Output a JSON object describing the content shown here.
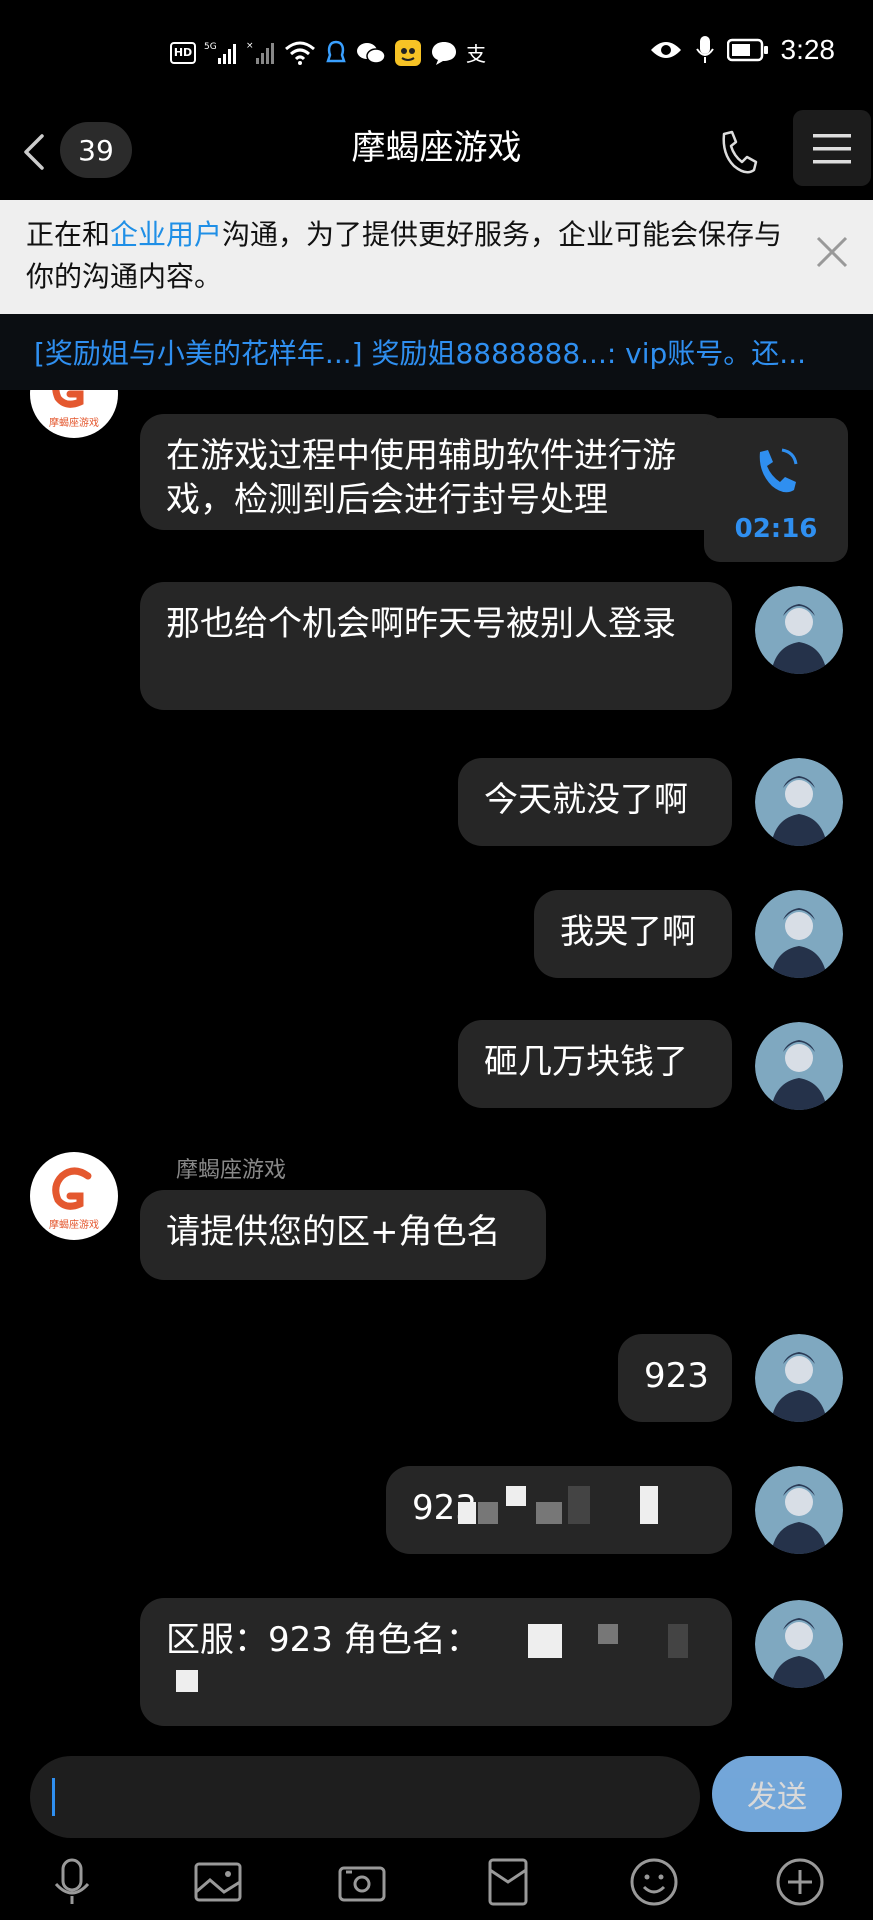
{
  "status_bar": {
    "time": "3:28",
    "hd_label": "HD",
    "icons": [
      "hd-icon",
      "signal-5g-icon",
      "signal-icon",
      "wifi-icon",
      "notification-icon",
      "wechat-icon",
      "app-icon",
      "chat-icon",
      "alipay-icon",
      "eye-icon",
      "mic-icon",
      "battery-icon"
    ],
    "alipay_glyph": "支"
  },
  "header": {
    "unread_count": "39",
    "title": "摩蝎座游戏",
    "icons": [
      "back-icon",
      "phone-icon",
      "menu-icon"
    ]
  },
  "notice": {
    "prefix": "正在和",
    "highlight": "企业用户",
    "suffix": "沟通，为了提供更好服务，企业可能会保存与你的沟通内容。",
    "highlight_color": "#1f8fe6"
  },
  "pinned": {
    "text": "[奖励姐与小美的花样年...] 奖励姐8888888...: vip账号。还..."
  },
  "game_account": {
    "name": "摩蝎座游戏",
    "logo_text": "摩蝎座游戏",
    "logo_color": "#e4582f"
  },
  "call": {
    "duration": "02:16"
  },
  "messages": [
    {
      "from": "game",
      "text": "在游戏过程中使用辅助软件进行游戏，检测到后会进行封号处理"
    },
    {
      "from": "me",
      "text": "那也给个机会啊昨天号被别人登录"
    },
    {
      "from": "me",
      "text": "今天就没了啊"
    },
    {
      "from": "me",
      "text": "我哭了啊"
    },
    {
      "from": "me",
      "text": "砸几万块钱了"
    },
    {
      "from": "game",
      "text": "请提供您的区+角色名"
    },
    {
      "from": "me",
      "text": "923"
    },
    {
      "from": "me",
      "text": "923"
    },
    {
      "from": "me",
      "text": "区服：923  角色名："
    }
  ],
  "input": {
    "send_label": "发送",
    "toolbar_icons": [
      "voice-icon",
      "image-icon",
      "camera-icon",
      "red-packet-icon",
      "emoji-icon",
      "plus-icon"
    ]
  },
  "colors": {
    "background": "#000000",
    "bubble": "#262626",
    "accent": "#2f8ff0",
    "send": "#87c3ff"
  }
}
